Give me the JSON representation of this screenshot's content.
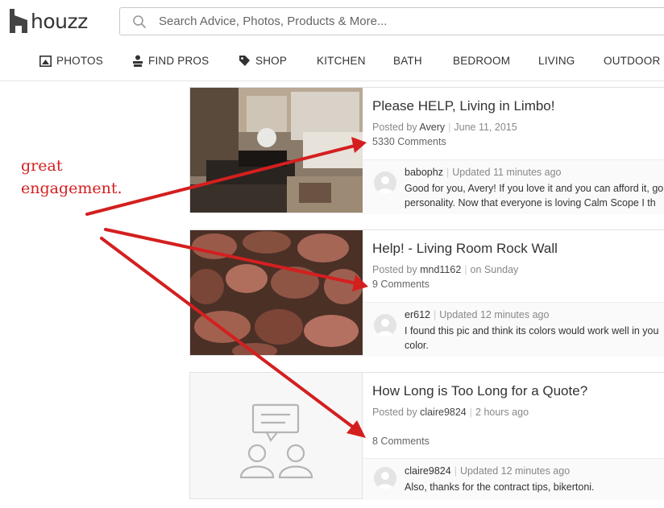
{
  "brand": {
    "name": "houzz"
  },
  "search": {
    "placeholder": "Search Advice, Photos, Products & More..."
  },
  "nav": [
    {
      "label": "PHOTOS",
      "icon": "photos-icon"
    },
    {
      "label": "FIND PROS",
      "icon": "find-pros-icon"
    },
    {
      "label": "SHOP",
      "icon": "shop-tag-icon"
    },
    {
      "label": "KITCHEN"
    },
    {
      "label": "BATH"
    },
    {
      "label": "BEDROOM"
    },
    {
      "label": "LIVING"
    },
    {
      "label": "OUTDOOR"
    }
  ],
  "annotation": {
    "line1": "great",
    "line2": "engagement."
  },
  "posts": [
    {
      "title": "Please HELP, Living in Limbo!",
      "posted_prefix": "Posted by",
      "author": "Avery",
      "date": "June 11, 2015",
      "comments": "5330 Comments",
      "reply_user": "babophz",
      "reply_updated": "Updated 11 minutes ago",
      "reply_text": "Good for you, Avery! If you love it and you can afford it, go personality. Now that everyone is loving Calm Scope I th"
    },
    {
      "title": "Help! - Living Room Rock Wall",
      "posted_prefix": "Posted by",
      "author": "mnd1162",
      "date": "on Sunday",
      "comments": "9 Comments",
      "reply_user": "er612",
      "reply_updated": "Updated 12 minutes ago",
      "reply_text": "I found this pic and think its colors would work well in you color."
    },
    {
      "title": "How Long is Too Long for a Quote?",
      "posted_prefix": "Posted by",
      "author": "claire9824",
      "date": "2 hours ago",
      "comments": "8 Comments",
      "reply_user": "claire9824",
      "reply_updated": "Updated 12 minutes ago",
      "reply_text": "Also, thanks for the contract tips, bikertoni."
    }
  ],
  "colors": {
    "annotation_red": "#d41f1f",
    "brand_text": "#333333",
    "border": "#e2e2e2"
  }
}
